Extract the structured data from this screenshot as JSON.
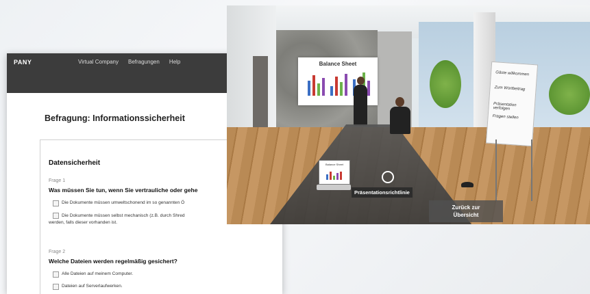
{
  "survey": {
    "brand": "PANY",
    "nav": [
      "Virtual Company",
      "Befragungen",
      "Help"
    ],
    "title": "Befragung: Informationssicherheit",
    "section_title": "Datensicherheit",
    "q1": {
      "label": "Frage 1",
      "text": "Was müssen Sie tun, wenn Sie vertrauliche oder gehe",
      "options": [
        "Die Dokumente müssen umweltschonend im so genannten Ö",
        "Die Dokumente müssen selbst mechanisch (z.B. durch Shred"
      ],
      "option2_cont": "werden, falls dieser vorhanden ist."
    },
    "q2": {
      "label": "Frage 2",
      "text": "Welche Dateien werden regelmäßig gesichert?",
      "options": [
        "Alle Dateien auf meinem Computer.",
        "Dateien auf Serverlaufwerken."
      ]
    }
  },
  "scene": {
    "board_title": "Balance Sheet",
    "laptop_title": "Balance Sheet",
    "object_label": "Präsentationsrichtlinie",
    "back_button": [
      "Zurück zur",
      "Übersicht"
    ],
    "flipchart_lines": [
      "Gäste willkommen",
      "Zum Wortbeitrag",
      "Präsentation verfolgen",
      "Fragen stellen"
    ],
    "colors": {
      "bar_blue": "#3b6fc4",
      "bar_red": "#c83a32",
      "bar_green": "#6cb24a",
      "bar_purple": "#8a4bb0"
    }
  }
}
